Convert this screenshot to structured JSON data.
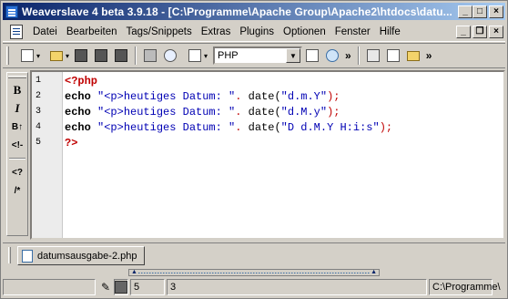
{
  "window": {
    "title": "Weaverslave 4 beta 3.9.18 - [C:\\Programme\\Apache Group\\Apache2\\htdocs\\datu...",
    "controls": {
      "minimize": "_",
      "maximize": "□",
      "close": "×"
    }
  },
  "menubar": {
    "items": [
      "Datei",
      "Bearbeiten",
      "Tags/Snippets",
      "Extras",
      "Plugins",
      "Optionen",
      "Fenster",
      "Hilfe"
    ],
    "mdi_controls": {
      "minimize": "_",
      "restore": "❐",
      "close": "×"
    }
  },
  "toolbar": {
    "language": "PHP",
    "overflow": "»"
  },
  "leftbar": {
    "items": [
      "B",
      "I",
      "B↑",
      "<!-",
      "<?",
      "/*"
    ]
  },
  "editor": {
    "lines": [
      {
        "num": "1",
        "tokens": [
          {
            "t": "<?php",
            "c": "tag"
          }
        ]
      },
      {
        "num": "2",
        "tokens": [
          {
            "t": "echo ",
            "c": "kw"
          },
          {
            "t": "\"<p>heutiges Datum: \"",
            "c": "str"
          },
          {
            "t": ". ",
            "c": "punc"
          },
          {
            "t": "date(",
            "c": "fn"
          },
          {
            "t": "\"d.m.Y\"",
            "c": "str"
          },
          {
            "t": ");",
            "c": "punc"
          }
        ]
      },
      {
        "num": "3",
        "tokens": [
          {
            "t": "echo ",
            "c": "kw"
          },
          {
            "t": "\"<p>heutiges Datum: \"",
            "c": "str"
          },
          {
            "t": ". ",
            "c": "punc"
          },
          {
            "t": "date(",
            "c": "fn"
          },
          {
            "t": "\"d.M.y\"",
            "c": "str"
          },
          {
            "t": ");",
            "c": "punc"
          }
        ]
      },
      {
        "num": "4",
        "tokens": [
          {
            "t": "echo ",
            "c": "kw"
          },
          {
            "t": "\"<p>heutiges Datum: \"",
            "c": "str"
          },
          {
            "t": ". ",
            "c": "punc"
          },
          {
            "t": "date(",
            "c": "fn"
          },
          {
            "t": "\"D d.M.Y H:i:s\"",
            "c": "str"
          },
          {
            "t": ");",
            "c": "punc"
          }
        ]
      },
      {
        "num": "5",
        "tokens": [
          {
            "t": "?>",
            "c": "tag"
          }
        ]
      }
    ]
  },
  "tabs": [
    {
      "label": "datumsausgabe-2.php"
    }
  ],
  "statusbar": {
    "line": "5",
    "column": "3",
    "path": "C:\\Programme\\"
  }
}
